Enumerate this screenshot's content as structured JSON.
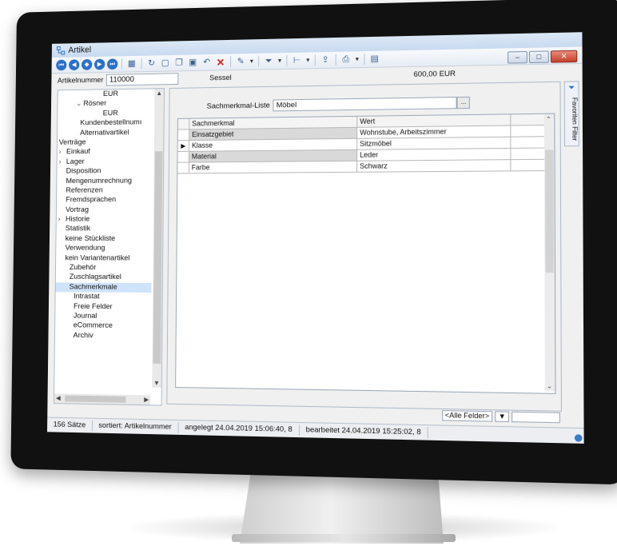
{
  "window": {
    "title": "Artikel"
  },
  "header": {
    "artikelnummer_label": "Artikelnummer",
    "artikelnummer_value": "110000",
    "name": "Sessel",
    "price": "600,00 EUR"
  },
  "tree": {
    "items": [
      {
        "label": "EUR",
        "indent": 60
      },
      {
        "label": "Rösner",
        "indent": 24,
        "chevron": "down"
      },
      {
        "label": "EUR",
        "indent": 60
      },
      {
        "label": "Kundenbestellnumı",
        "indent": 30
      },
      {
        "label": "Alternativartikel",
        "indent": 30
      },
      {
        "label": "Verträge",
        "indent": 2
      },
      {
        "label": "Einkauf",
        "indent": 2,
        "chevron": "right"
      },
      {
        "label": "Lager",
        "indent": 2,
        "chevron": "right"
      },
      {
        "label": "Disposition",
        "indent": 12
      },
      {
        "label": "Mengenumrechnung",
        "indent": 12
      },
      {
        "label": "Referenzen",
        "indent": 12
      },
      {
        "label": "Fremdsprachen",
        "indent": 12
      },
      {
        "label": "Vortrag",
        "indent": 12
      },
      {
        "label": "Historie",
        "indent": 2,
        "chevron": "right"
      },
      {
        "label": "Statistik",
        "indent": 12
      },
      {
        "label": "keine Stückliste",
        "indent": 12
      },
      {
        "label": "Verwendung",
        "indent": 12
      },
      {
        "label": "kein Variantenartikel",
        "indent": 12
      },
      {
        "label": "Zubehör",
        "indent": 18
      },
      {
        "label": "Zuschlagsartikel",
        "indent": 18
      },
      {
        "label": "Sachmerkmale",
        "indent": 18,
        "selected": true
      },
      {
        "label": "Intrastat",
        "indent": 24
      },
      {
        "label": "Freie Felder",
        "indent": 24
      },
      {
        "label": "Journal",
        "indent": 24
      },
      {
        "label": "eCommerce",
        "indent": 24
      },
      {
        "label": "Archiv",
        "indent": 24
      }
    ]
  },
  "main": {
    "liste_label": "Sachmerkmal-Liste",
    "liste_value": "Möbel",
    "dots": "...",
    "columns": [
      "Sachmerkmal",
      "Wert"
    ],
    "rows": [
      {
        "c1": "Einsatzgebiet",
        "c2": "Wohnstube, Arbeitszimmer",
        "shade": true,
        "mark": ""
      },
      {
        "c1": "Klasse",
        "c2": "Sitzmöbel",
        "shade": false,
        "mark": "▶"
      },
      {
        "c1": "Material",
        "c2": "Leder",
        "shade": true,
        "mark": ""
      },
      {
        "c1": "Farbe",
        "c2": "Schwarz",
        "shade": false,
        "mark": ""
      }
    ],
    "field_filter": "<Alle Felder>"
  },
  "sidetab": {
    "label": "Favoriten Filter"
  },
  "status": {
    "count": "156 Sätze",
    "sorted": "sortiert: Artikelnummer",
    "created": "angelegt 24.04.2019 15:06:40,  8",
    "edited": "bearbeitet 24.04.2019 15:25:02,  8"
  },
  "colors": {
    "accent": "#2a6fc9",
    "selection": "#cfe3fb",
    "close": "#c3412a"
  }
}
